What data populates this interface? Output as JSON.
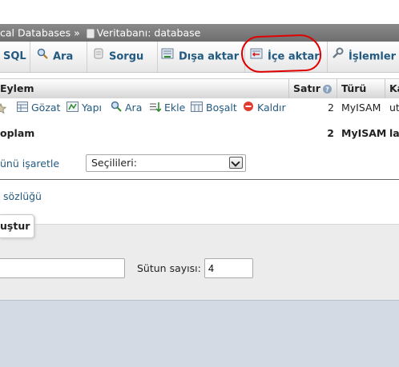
{
  "breadcrumb": {
    "server": "cal Databases",
    "separator": "»",
    "db_label": "Veritabanı: database"
  },
  "tabs": [
    {
      "label": "SQL",
      "icon": "sql-icon"
    },
    {
      "label": "Ara",
      "icon": "search-icon"
    },
    {
      "label": "Sorgu",
      "icon": "query-icon"
    },
    {
      "label": "Dışa aktar",
      "icon": "export-icon"
    },
    {
      "label": "İçe aktar",
      "icon": "import-icon"
    },
    {
      "label": "İşlemler",
      "icon": "wrench-icon"
    }
  ],
  "table": {
    "headers": {
      "eylem": "Eylem",
      "satir": "Satır",
      "turu": "Türü",
      "ka": "Ka"
    },
    "row": {
      "actions": [
        "Gözat",
        "Yapı",
        "Ara",
        "Ekle",
        "Boşalt",
        "Kaldır"
      ],
      "rows": "2",
      "type": "MyISAM",
      "collation": "utf"
    },
    "total": {
      "label": "oplam",
      "rows": "2",
      "type": "MyISAM",
      "collation": "lat"
    }
  },
  "bulk": {
    "check_label": "ünü işaretle",
    "select_value": "Seçilileri:"
  },
  "dict_link": "sözlüğü",
  "create": {
    "legend": "uştur",
    "columns_label": "Sütun sayısı:",
    "columns_value": "4",
    "name_value": ""
  },
  "colors": {
    "highlight_ring": "#e00000",
    "link": "#235a81",
    "footer": "#d3dae3"
  }
}
